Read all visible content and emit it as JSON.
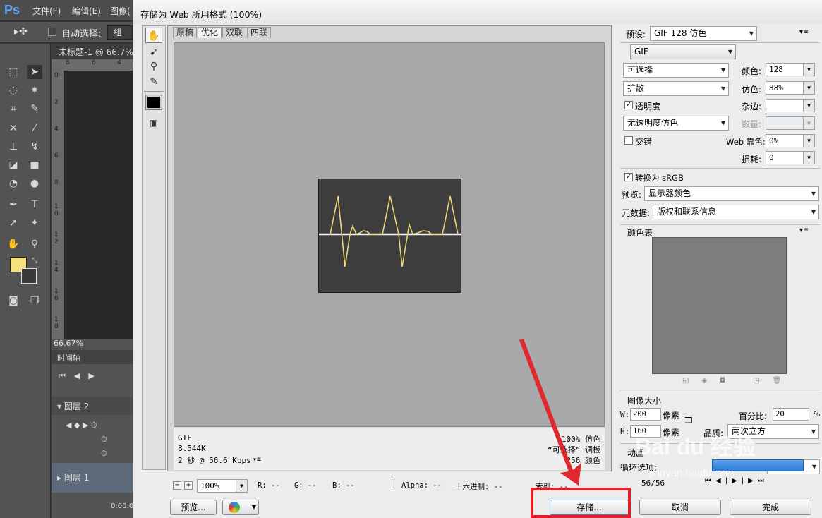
{
  "ps": {
    "logo": "Ps",
    "menu": [
      "文件(F)",
      "编辑(E)",
      "图像("
    ],
    "options": {
      "auto_select": "自动选择:",
      "group": "组"
    },
    "doc_tab": "未标题-1 @ 66.7%",
    "ruler_top": [
      "8",
      "6",
      "4"
    ],
    "ruler_left": [
      "0",
      "2",
      "4",
      "6",
      "8",
      "1\n0",
      "1\n2",
      "1\n4",
      "1\n6",
      "1\n8"
    ],
    "zoom_status": "66.67%",
    "timeline": {
      "title": "时间轴",
      "layer2": "图层 2",
      "layer1": "图层 1",
      "time": "0:00:0"
    },
    "fg_color": "#f5e27a",
    "bg_color": "#3a3a3a"
  },
  "dialog": {
    "title": "存储为 Web 所用格式 (100%)",
    "tabs": [
      "原稿",
      "优化",
      "双联",
      "四联"
    ],
    "active_tab": 1,
    "info": {
      "format": "GIF",
      "size": "8.544K",
      "speed": "2 秒 @ 56.6 Kbps",
      "dither": "100% 仿色",
      "palette": "“可选择” 调板",
      "colors": "256 颜色"
    },
    "bottom": {
      "zoom": "100%",
      "r": "R: --",
      "g": "G: --",
      "b": "B: --",
      "alpha": "Alpha: --",
      "hex": "十六进制: --",
      "index": "索引: --"
    },
    "buttons": {
      "preview": "预览...",
      "save": "存储...",
      "cancel": "取消",
      "done": "完成"
    }
  },
  "panel": {
    "preset_label": "预设:",
    "preset_value": "GIF 128 仿色",
    "format": "GIF",
    "reduction": "可选择",
    "dither_algo": "扩散",
    "transparency_label": "透明度",
    "transparency_checked": true,
    "matte_dither": "无透明度仿色",
    "interlace_label": "交错",
    "interlace_checked": false,
    "colors_label": "颜色:",
    "colors_value": "128",
    "dither_label": "仿色:",
    "dither_value": "88%",
    "matte_label": "杂边:",
    "matte_value": "",
    "amount_label": "数量:",
    "amount_value": "",
    "web_snap_label": "Web 靠色:",
    "web_snap_value": "0%",
    "lossy_label": "损耗:",
    "lossy_value": "0",
    "convert_srgb_label": "转换为 sRGB",
    "convert_srgb_checked": true,
    "preview_label": "预览:",
    "preview_value": "显示器颜色",
    "metadata_label": "元数据:",
    "metadata_value": "版权和联系信息",
    "color_table_label": "颜色表",
    "image_size_label": "图像大小",
    "w_label": "W:",
    "w_value": "200",
    "h_label": "H:",
    "h_value": "160",
    "unit": "像素",
    "percent_label": "百分比:",
    "percent_value": "20",
    "percent_unit": "%",
    "quality_label": "品质:",
    "quality_value": "两次立方",
    "animation_label": "动画",
    "loop_label": "循环选项:",
    "frame_counter": "56/56"
  },
  "watermark": {
    "brand": "Bai du 经验",
    "url": "jingyan.baidu.com"
  }
}
